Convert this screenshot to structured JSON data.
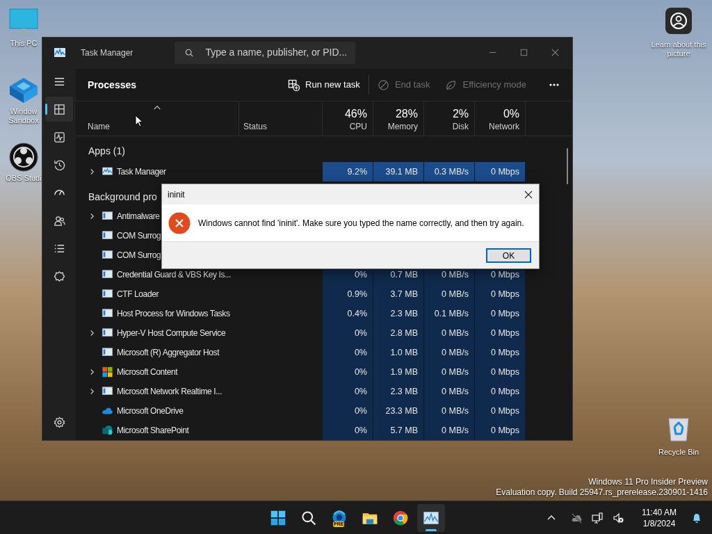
{
  "desktop_icons": [
    {
      "kind": "monitor",
      "label": "This PC"
    },
    {
      "kind": "sandbox",
      "label": "Window Sandbox"
    },
    {
      "kind": "obs",
      "label": "OBS Studi"
    }
  ],
  "learn_about_picture": {
    "label": "Learn about this picture"
  },
  "recycle_bin": {
    "label": "Recycle Bin"
  },
  "task_manager": {
    "title": "Task Manager",
    "search": {
      "placeholder": "Type a name, publisher, or PID..."
    },
    "nav": [
      {
        "kind": "menu",
        "selected": false
      },
      {
        "kind": "processes",
        "selected": true
      },
      {
        "kind": "performance",
        "selected": false
      },
      {
        "kind": "history",
        "selected": false
      },
      {
        "kind": "startup",
        "selected": false
      },
      {
        "kind": "users",
        "selected": false
      },
      {
        "kind": "details",
        "selected": false
      },
      {
        "kind": "services",
        "selected": false
      },
      {
        "kind": "settings",
        "selected": false
      }
    ],
    "page_title": "Processes",
    "toolbar": [
      {
        "kind": "run",
        "label": "Run new task",
        "disabled": false
      },
      {
        "kind": "end",
        "label": "End task",
        "disabled": true
      },
      {
        "kind": "efficiency",
        "label": "Efficiency mode",
        "disabled": true
      },
      {
        "kind": "more"
      }
    ],
    "columns": [
      {
        "label": "Name",
        "sorted": true
      },
      {
        "label": "Status",
        "sorted": false
      },
      {
        "usage": "46%",
        "label": "CPU",
        "sorted": false
      },
      {
        "usage": "28%",
        "label": "Memory",
        "sorted": false
      },
      {
        "usage": "2%",
        "label": "Disk",
        "sorted": false
      },
      {
        "usage": "0%",
        "label": "Network",
        "sorted": false
      }
    ],
    "groups": [
      {
        "title": "Apps (1)",
        "rows": [
          {
            "name": "Task Manager",
            "kind": "taskmanager",
            "expandable": true,
            "highlight": true,
            "cpu": "9.2%",
            "memory": "39.1 MB",
            "disk": "0.3 MB/s",
            "network": "0 Mbps"
          }
        ]
      },
      {
        "title": "Background pro",
        "rows": [
          {
            "name": "Antimalware",
            "kind": "app",
            "expandable": true,
            "highlight": false
          },
          {
            "name": "COM Surrog",
            "kind": "app",
            "expandable": false
          },
          {
            "name": "COM Surrog",
            "kind": "app",
            "expandable": false
          },
          {
            "name": "Credential Guard & VBS Key Is...",
            "kind": "app",
            "expandable": false,
            "highlight": false,
            "cpu": "0%",
            "memory": "0.7 MB",
            "disk": "0 MB/s",
            "network": "0 Mbps"
          },
          {
            "name": "CTF Loader",
            "kind": "app",
            "expandable": false,
            "highlight": false,
            "cpu": "0.9%",
            "memory": "3.7 MB",
            "disk": "0 MB/s",
            "network": "0 Mbps"
          },
          {
            "name": "Host Process for Windows Tasks",
            "kind": "app",
            "expandable": false,
            "highlight": false,
            "cpu": "0.4%",
            "memory": "2.3 MB",
            "disk": "0.1 MB/s",
            "network": "0 Mbps"
          },
          {
            "name": "Hyper-V Host Compute Service",
            "kind": "app",
            "expandable": true,
            "highlight": false,
            "cpu": "0%",
            "memory": "2.8 MB",
            "disk": "0 MB/s",
            "network": "0 Mbps"
          },
          {
            "name": "Microsoft (R) Aggregator Host",
            "kind": "app",
            "expandable": false,
            "highlight": false,
            "cpu": "0%",
            "memory": "1.0 MB",
            "disk": "0 MB/s",
            "network": "0 Mbps"
          },
          {
            "name": "Microsoft Content",
            "kind": "windows",
            "expandable": true,
            "highlight": false,
            "cpu": "0%",
            "memory": "1.9 MB",
            "disk": "0 MB/s",
            "network": "0 Mbps"
          },
          {
            "name": "Microsoft Network Realtime I...",
            "kind": "app",
            "expandable": true,
            "highlight": false,
            "cpu": "0%",
            "memory": "2.3 MB",
            "disk": "0 MB/s",
            "network": "0 Mbps"
          },
          {
            "name": "Microsoft OneDrive",
            "kind": "cloud",
            "expandable": false,
            "highlight": false,
            "cpu": "0%",
            "memory": "23.3 MB",
            "disk": "0 MB/s",
            "network": "0 Mbps"
          },
          {
            "name": "Microsoft SharePoint",
            "kind": "sharepoint",
            "expandable": false,
            "highlight": false,
            "cpu": "0%",
            "memory": "5.7 MB",
            "disk": "0 MB/s",
            "network": "0 Mbps"
          }
        ]
      }
    ]
  },
  "dialog": {
    "title": "ininit",
    "message": "Windows cannot find 'ininit'. Make sure you typed the name correctly, and then try again.",
    "button": "OK"
  },
  "watermark": [
    "Windows 11 Pro Insider Preview",
    "Evaluation copy. Build 25947.rs_prerelease.230901-1416"
  ],
  "taskbar": {
    "apps": [
      {
        "kind": "start",
        "active": false
      },
      {
        "kind": "search",
        "active": false
      },
      {
        "kind": "edge",
        "badge": "PRE",
        "active": false
      },
      {
        "kind": "explorer",
        "active": false
      },
      {
        "kind": "chrome",
        "active": false
      },
      {
        "kind": "taskmanager",
        "active": true
      }
    ],
    "tray": [
      {
        "kind": "chevron"
      },
      {
        "kind": "cloud-off"
      },
      {
        "kind": "network"
      },
      {
        "kind": "volume-muted"
      }
    ],
    "time": "11:40 AM",
    "date": "1/8/2024"
  }
}
